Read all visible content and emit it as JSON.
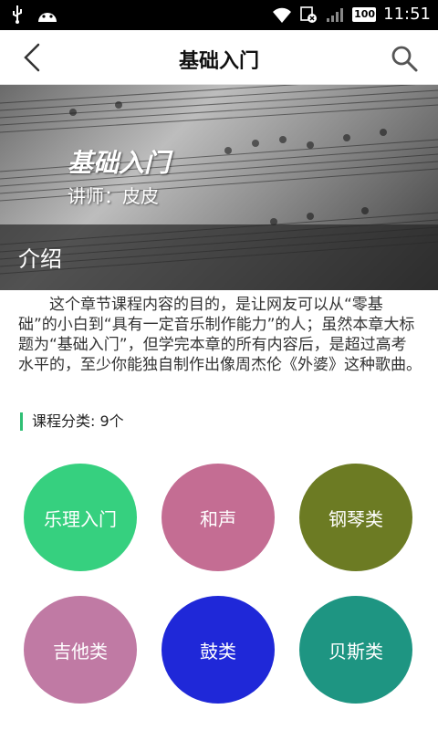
{
  "status_bar": {
    "time": "11:51",
    "battery": "100",
    "icons": [
      "usb-icon",
      "android-icon",
      "wifi-icon",
      "sim-icon",
      "signal-icon",
      "battery-icon"
    ]
  },
  "header": {
    "title": "基础入门",
    "back_icon": "chevron-left-icon",
    "search_icon": "search-icon"
  },
  "banner": {
    "title": "基础入门",
    "teacher": "讲师：皮皮",
    "section_label": "介绍"
  },
  "description": "这个章节课程内容的目的，是让网友可以从“零基础”的小白到“具有一定音乐制作能力”的人；虽然本章大标题为“基础入门”，但学完本章的所有内容后，是超过高考水平的，至少你能独自制作出像周杰伦《外婆》这种歌曲。",
  "category": {
    "label": "课程分类: 9个",
    "accent": "#2fbf74",
    "items": [
      {
        "label": "乐理入门",
        "color": "#36d07f"
      },
      {
        "label": "和声",
        "color": "#c46d93"
      },
      {
        "label": "钢琴类",
        "color": "#6c7b23"
      },
      {
        "label": "吉他类",
        "color": "#c07aa4"
      },
      {
        "label": "鼓类",
        "color": "#1f28d8"
      },
      {
        "label": "贝斯类",
        "color": "#1e9582"
      }
    ]
  }
}
